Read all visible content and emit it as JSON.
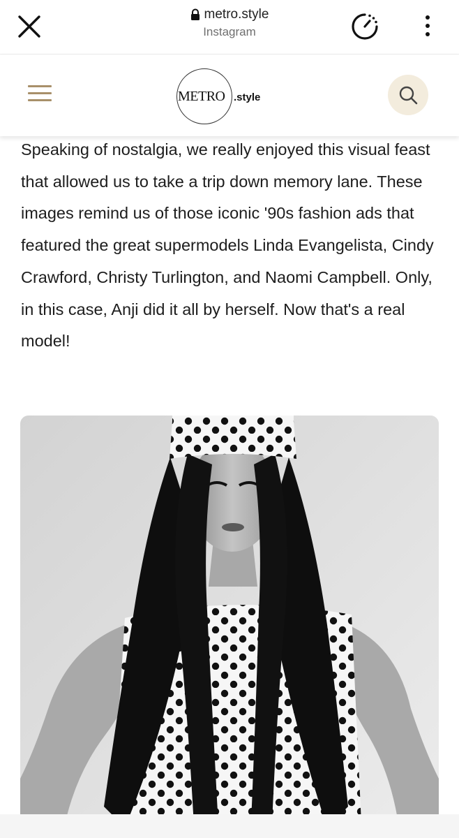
{
  "browser": {
    "url": "metro.style",
    "subtitle": "Instagram",
    "icons": [
      "close-icon",
      "lock-icon",
      "timer-icon",
      "more-vert-icon"
    ]
  },
  "site_header": {
    "logo_main": "METRO",
    "logo_suffix": ".style",
    "icons": [
      "menu-icon",
      "search-icon"
    ],
    "accent_color": "#a8906a",
    "search_bg": "#f3ecdd"
  },
  "article": {
    "paragraph": "Speaking of nostalgia, we really enjoyed this visual feast that allowed us to take a trip down memory lane. These images remind us of those iconic '90s fashion ads that featured the great supermodels Linda Evangelista, Cindy Crawford, Christy Turlington, and Naomi Campbell. Only, in this case, Anji did it all by herself. Now that's a real model!"
  },
  "photo": {
    "style": "black-and-white"
  }
}
